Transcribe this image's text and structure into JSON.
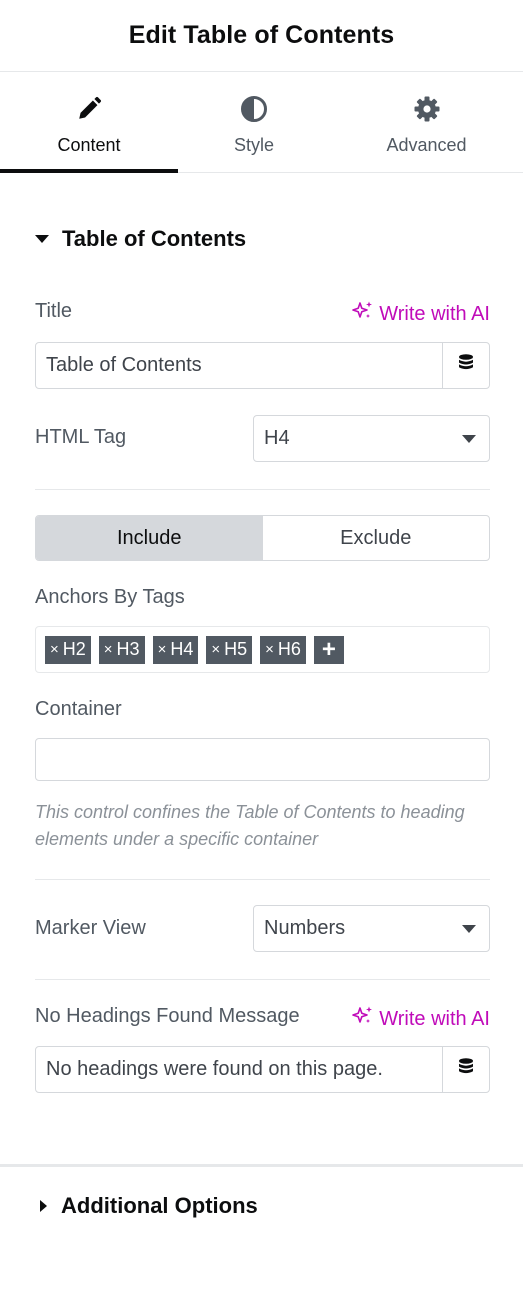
{
  "panel": {
    "title": "Edit Table of Contents"
  },
  "tabs": [
    {
      "label": "Content",
      "icon": "pencil-icon",
      "active": true
    },
    {
      "label": "Style",
      "icon": "contrast-icon",
      "active": false
    },
    {
      "label": "Advanced",
      "icon": "gear-icon",
      "active": false
    }
  ],
  "section": {
    "title": "Table of Contents",
    "expanded": true
  },
  "fields": {
    "title": {
      "label": "Title",
      "value": "Table of Contents",
      "ai_label": "Write with AI"
    },
    "html_tag": {
      "label": "HTML Tag",
      "value": "H4"
    },
    "include_exclude": {
      "options": [
        "Include",
        "Exclude"
      ],
      "selected": "Include"
    },
    "anchors": {
      "label": "Anchors By Tags",
      "tags": [
        "H2",
        "H3",
        "H4",
        "H5",
        "H6"
      ],
      "add_label": "+"
    },
    "container": {
      "label": "Container",
      "value": "",
      "help": "This control confines the Table of Contents to heading elements under a specific container"
    },
    "marker_view": {
      "label": "Marker View",
      "value": "Numbers"
    },
    "no_headings": {
      "label": "No Headings Found Message",
      "value": "No headings were found on this page.",
      "ai_label": "Write with AI"
    }
  },
  "section2": {
    "title": "Additional Options",
    "expanded": false
  },
  "colors": {
    "accent_ai": "#c00bb9",
    "tag_bg": "#515962",
    "active_tab": "#0c0d0e"
  },
  "icons": {
    "ai": "sparkle-icon",
    "dynamic": "database-icon",
    "remove_tag": "x-icon"
  }
}
